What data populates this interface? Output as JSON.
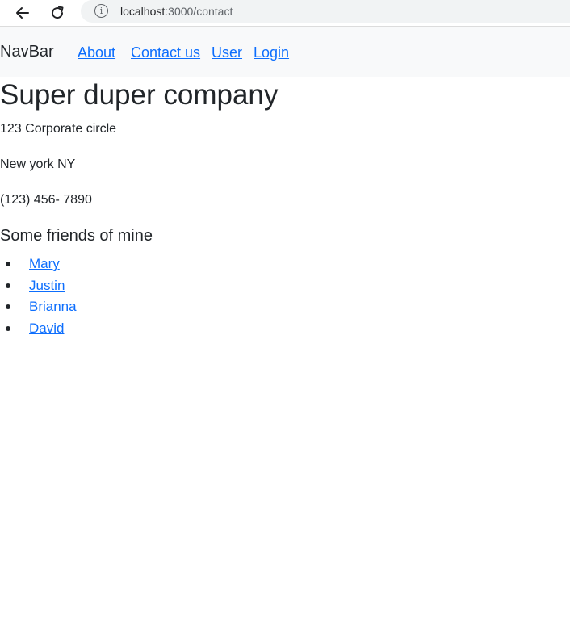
{
  "browser": {
    "url_host": "localhost",
    "url_path": ":3000/contact",
    "info_icon_glyph": "i"
  },
  "navbar": {
    "brand": "NavBar",
    "links": [
      {
        "label": "About"
      },
      {
        "label": "Contact us"
      },
      {
        "label": "User"
      },
      {
        "label": "Login"
      }
    ]
  },
  "company": {
    "name": "Super duper company",
    "street": "123 Corporate circle",
    "city": "New york NY",
    "phone": "(123) 456- 7890"
  },
  "friends": {
    "heading": "Some friends of mine",
    "items": [
      {
        "name": "Mary"
      },
      {
        "name": "Justin"
      },
      {
        "name": "Brianna"
      },
      {
        "name": "David"
      }
    ]
  },
  "colors": {
    "link": "#0d6efd",
    "text": "#212529",
    "navbar_bg": "#f8f9fa"
  },
  "icons": {
    "back": "back-arrow-icon",
    "reload": "reload-icon",
    "info": "info-icon"
  }
}
